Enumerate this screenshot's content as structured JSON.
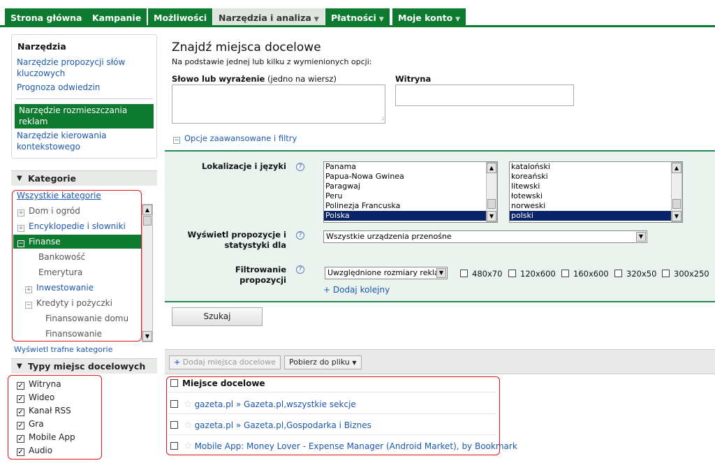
{
  "nav": {
    "tabs": [
      "Strona główna",
      "Kampanie",
      "Możliwości",
      "Narzędzia i analiza",
      "Płatności",
      "Moje konto"
    ],
    "dropdown": "▼"
  },
  "tools": {
    "title": "Narzędzia",
    "links": [
      "Narzędzie propozycji słów kluczowych",
      "Prognoza odwiedzin",
      "Narzędzie rozmieszczania reklam",
      "Narzędzie kierowania kontekstowego"
    ]
  },
  "categories": {
    "header": "Kategorie",
    "all": "Wszystkie kategorie",
    "items": [
      "Dom i ogród",
      "Encyklopedie i słowniki",
      "Finanse",
      "Bankowość",
      "Emerytura",
      "Inwestowanie",
      "Kredyty i pożyczki",
      "Finansowanie domu",
      "Finansowanie"
    ],
    "show_link": "Wyświetl trafne kategorie"
  },
  "types": {
    "header": "Typy miejsc docelowych",
    "items": [
      "Witryna",
      "Wideo",
      "Kanał RSS",
      "Gra",
      "Mobile App",
      "Audio"
    ]
  },
  "main": {
    "title": "Znajdź miejsca docelowe",
    "subtitle": "Na podstawie jednej lub kilku z wymienionych opcji:",
    "keyword_label_bold": "Słowo lub wyrażenie",
    "keyword_label_note": " (jedno na wiersz)",
    "site_label": "Witryna",
    "advanced": "Opcje zaawansowane i filtry"
  },
  "filters": {
    "loc_label": "Lokalizacje i języki",
    "countries": [
      "Panama",
      "Papua-Nowa Gwinea",
      "Paragwaj",
      "Peru",
      "Polinezja Francuska",
      "Polska"
    ],
    "languages": [
      "kataloński",
      "koreański",
      "litewski",
      "łotewski",
      "norweski",
      "polski"
    ],
    "show_label_line1": "Wyświetl propozycje i",
    "show_label_line2": "statystyki dla",
    "devices": "Wszystkie urządzenia przenośne",
    "filter_label": "Filtrowanie propozycji",
    "filter_value": "Uwzględnione rozmiary reklam",
    "sizes": [
      "480x70",
      "120x600",
      "160x600",
      "320x50",
      "300x250"
    ],
    "add_more": "+ Dodaj kolejny",
    "help": "?"
  },
  "search_button": "Szukaj",
  "toolbar": {
    "add": "Dodaj miejsca docelowe",
    "download": "Pobierz do pliku"
  },
  "results": {
    "header": "Miejsce docelowe",
    "rows": [
      {
        "domain": "gazeta.pl",
        "sep": " » ",
        "name": "Gazeta.pl,wszystkie sekcje"
      },
      {
        "domain": "gazeta.pl",
        "sep": " » ",
        "name": "Gazeta.pl,Gospodarka i Biznes"
      },
      {
        "domain": "",
        "sep": "",
        "name": "Mobile App: Money Lover - Expense Manager (Android Market), by Bookmark"
      }
    ]
  },
  "colors": {
    "nav_green": "#0e7a2f",
    "highlight_red": "#e0151b",
    "link_blue": "#1c58b0"
  }
}
